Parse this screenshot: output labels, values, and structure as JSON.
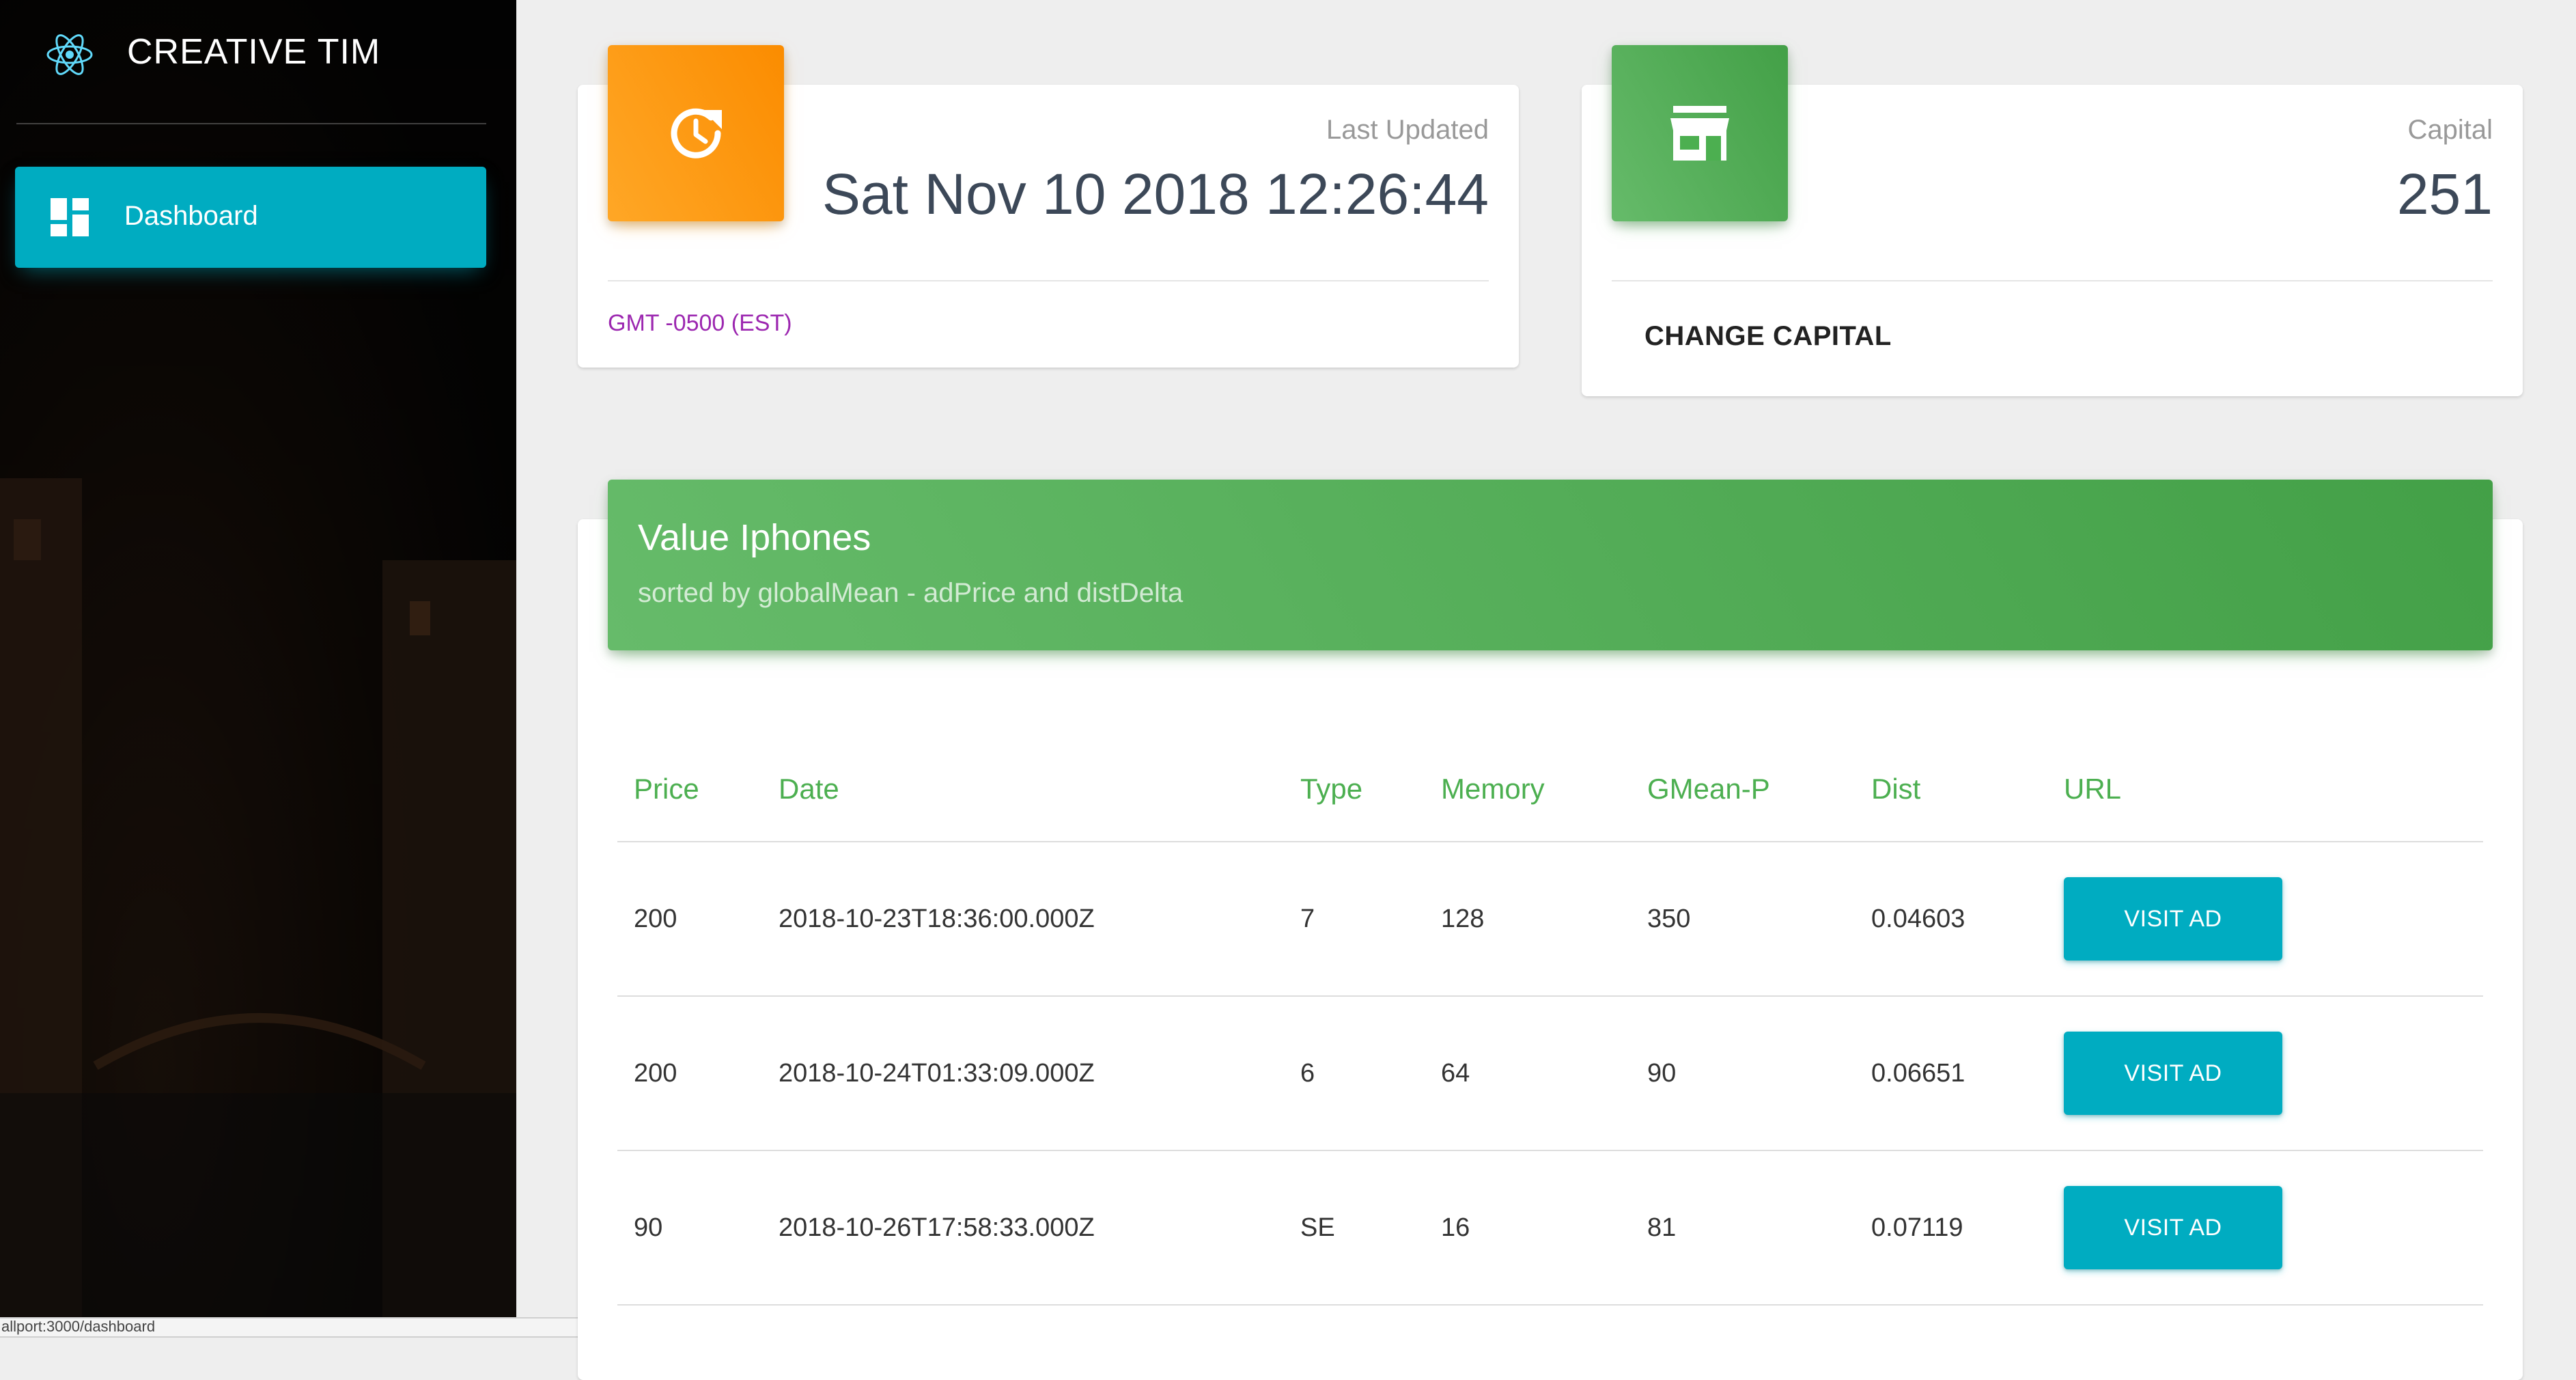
{
  "sidebar": {
    "brand": "CREATIVE TIM",
    "logo_icon": "react-atom-icon",
    "items": [
      {
        "label": "Dashboard",
        "icon": "dashboard-icon",
        "active": true
      }
    ],
    "status_url": "allport:3000/dashboard"
  },
  "stats": {
    "updated": {
      "icon": "update-clock-icon",
      "category": "Last Updated",
      "value": "Sat Nov 10 2018 12:26:44",
      "footer": "GMT -0500 (EST)"
    },
    "capital": {
      "icon": "store-icon",
      "category": "Capital",
      "value": "251",
      "action_label": "CHANGE CAPITAL"
    }
  },
  "table": {
    "title": "Value Iphones",
    "subtitle": "sorted by globalMean - adPrice and distDelta",
    "columns": [
      "Price",
      "Date",
      "Type",
      "Memory",
      "GMean-P",
      "Dist",
      "URL"
    ],
    "rows": [
      {
        "price": "200",
        "date": "2018-10-23T18:36:00.000Z",
        "type": "7",
        "memory": "128",
        "gmean": "350",
        "dist": "0.04603",
        "url_label": "VISIT AD"
      },
      {
        "price": "200",
        "date": "2018-10-24T01:33:09.000Z",
        "type": "6",
        "memory": "64",
        "gmean": "90",
        "dist": "0.06651",
        "url_label": "VISIT AD"
      },
      {
        "price": "90",
        "date": "2018-10-26T17:58:33.000Z",
        "type": "SE",
        "memory": "16",
        "gmean": "81",
        "dist": "0.07119",
        "url_label": "VISIT AD"
      }
    ]
  },
  "colors": {
    "accent_cyan": "#00acc1",
    "orange": "#fb8c00",
    "green": "#43a047",
    "purple": "#9c27b0"
  }
}
